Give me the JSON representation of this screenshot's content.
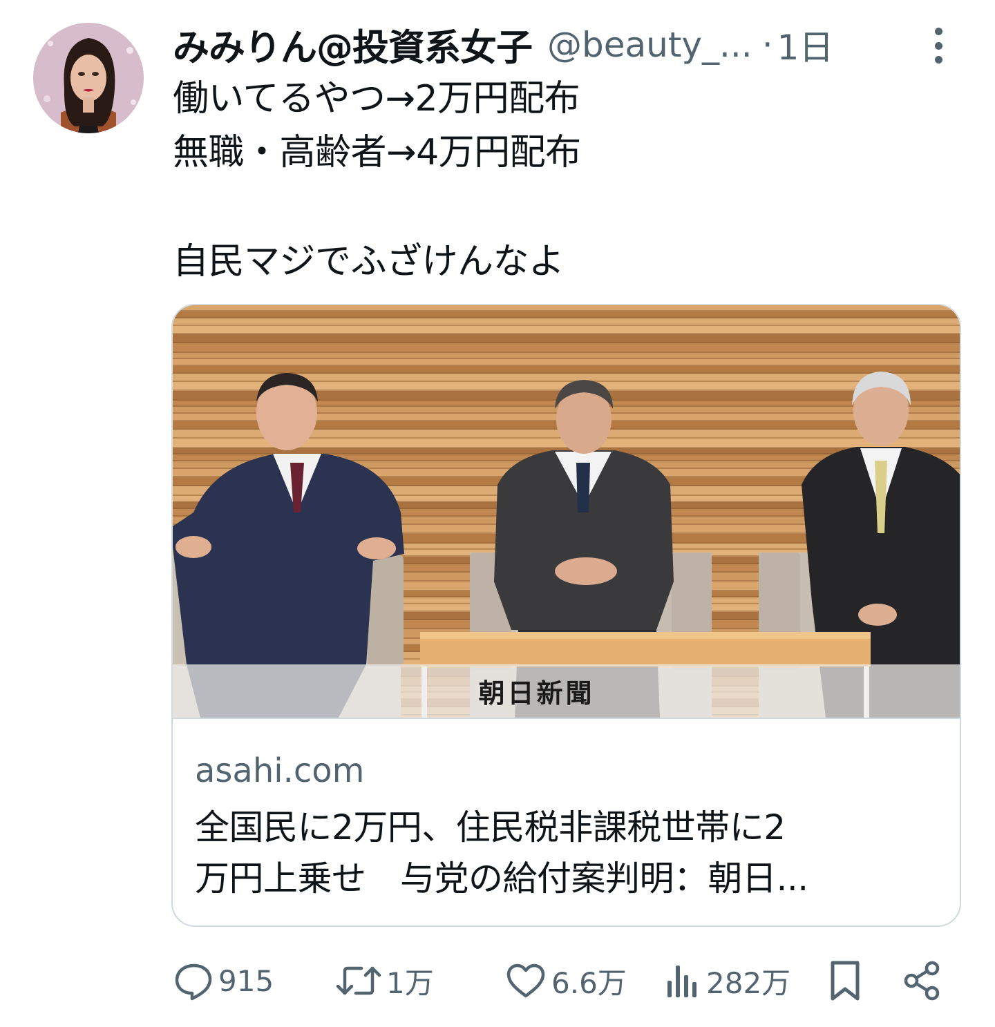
{
  "post": {
    "display_name": "みみりん@投資系女子",
    "handle": "@beauty_...",
    "separator": "·",
    "time": "1日",
    "text_lines": [
      "働いてるやつ→2万円配布",
      "無職・高齢者→4万円配布",
      "自民マジでふざけんなよ"
    ]
  },
  "card": {
    "image_watermark": "朝日新聞",
    "domain": "asahi.com",
    "title_lines": [
      "全国民に2万円、住民税非課税世帯に2",
      "万円上乗せ　与党の給付案判明：朝日..."
    ]
  },
  "actions": {
    "replies": "915",
    "reposts": "1万",
    "likes": "6.6万",
    "views": "282万"
  },
  "icons": {
    "reply": "speech-bubble-icon",
    "repost": "repost-arrows-icon",
    "like": "heart-icon",
    "views": "bar-chart-icon",
    "bookmark": "bookmark-icon",
    "share": "share-icon",
    "more": "vertical-dots-icon"
  },
  "colors": {
    "text": "#0f1419",
    "secondary": "#536471",
    "border": "#cfd9de"
  }
}
